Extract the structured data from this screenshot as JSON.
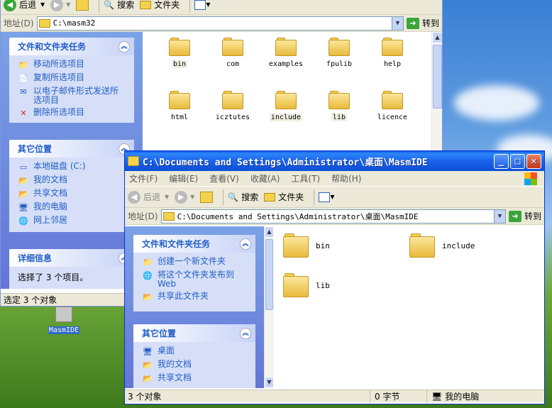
{
  "back_window": {
    "toolbar": {
      "back": "后退",
      "search": "搜索",
      "folders": "文件夹"
    },
    "address": {
      "label": "地址(D)",
      "path": "C:\\masm32",
      "go": "转到"
    },
    "tasks": {
      "title": "文件和文件夹任务",
      "items": [
        "移动所选项目",
        "复制所选项目",
        "以电子邮件形式发送所选项目",
        "删除所选项目"
      ]
    },
    "other_places": {
      "title": "其它位置",
      "items": [
        "本地磁盘 (C:)",
        "我的文档",
        "共享文档",
        "我的电脑",
        "网上邻居"
      ]
    },
    "details": {
      "title": "详细信息",
      "text": "选择了 3 个项目。"
    },
    "folders": [
      "bin",
      "com",
      "examples",
      "fpulib",
      "help",
      "html",
      "icztutes",
      "include",
      "lib",
      "licence"
    ],
    "status": "选定 3 个对象"
  },
  "front_window": {
    "title": "C:\\Documents and Settings\\Administrator\\桌面\\MasmIDE",
    "menu": [
      "文件(F)",
      "编辑(E)",
      "查看(V)",
      "收藏(A)",
      "工具(T)",
      "帮助(H)"
    ],
    "toolbar": {
      "back": "后退",
      "search": "搜索",
      "folders": "文件夹"
    },
    "address": {
      "label": "地址(D)",
      "path": "C:\\Documents and Settings\\Administrator\\桌面\\MasmIDE",
      "go": "转到"
    },
    "tasks": {
      "title": "文件和文件夹任务",
      "items": [
        "创建一个新文件夹",
        "将这个文件夹发布到Web",
        "共享此文件夹"
      ]
    },
    "other_places": {
      "title": "其它位置",
      "items": [
        "桌面",
        "我的文档",
        "共享文档"
      ]
    },
    "folders": [
      "bin",
      "include",
      "lib"
    ],
    "status": {
      "objects": "3 个对象",
      "size": "0 字节",
      "location": "我的电脑"
    }
  },
  "desktop_icon": {
    "label": "MasmIDE"
  }
}
